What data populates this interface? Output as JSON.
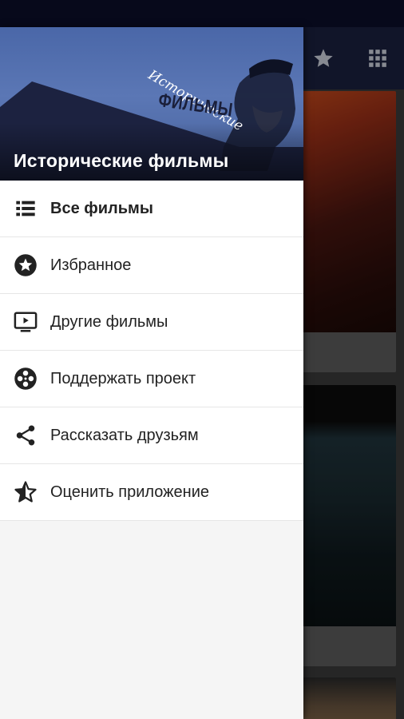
{
  "drawer": {
    "header_title": "Исторические фильмы",
    "logo_line1": "Исторические",
    "logo_line2": "ФИЛЬМЫ",
    "items": [
      {
        "label": "Все фильмы",
        "icon": "list-icon",
        "active": true
      },
      {
        "label": "Избранное",
        "icon": "star-badge-icon",
        "active": false
      },
      {
        "label": "Другие фильмы",
        "icon": "tv-play-icon",
        "active": false
      },
      {
        "label": "Поддержать проект",
        "icon": "film-reel-icon",
        "active": false
      },
      {
        "label": "Рассказать друзьям",
        "icon": "share-icon",
        "active": false
      },
      {
        "label": "Оценить приложение",
        "icon": "star-outline-icon",
        "active": false
      }
    ]
  },
  "toolbar": {
    "icons": [
      "star-icon",
      "grid-icon"
    ]
  },
  "colors": {
    "status_bar": "#0b0f2a",
    "toolbar": "#1b2140",
    "header_bg": "#5b77b5",
    "menu_text": "#222222"
  }
}
